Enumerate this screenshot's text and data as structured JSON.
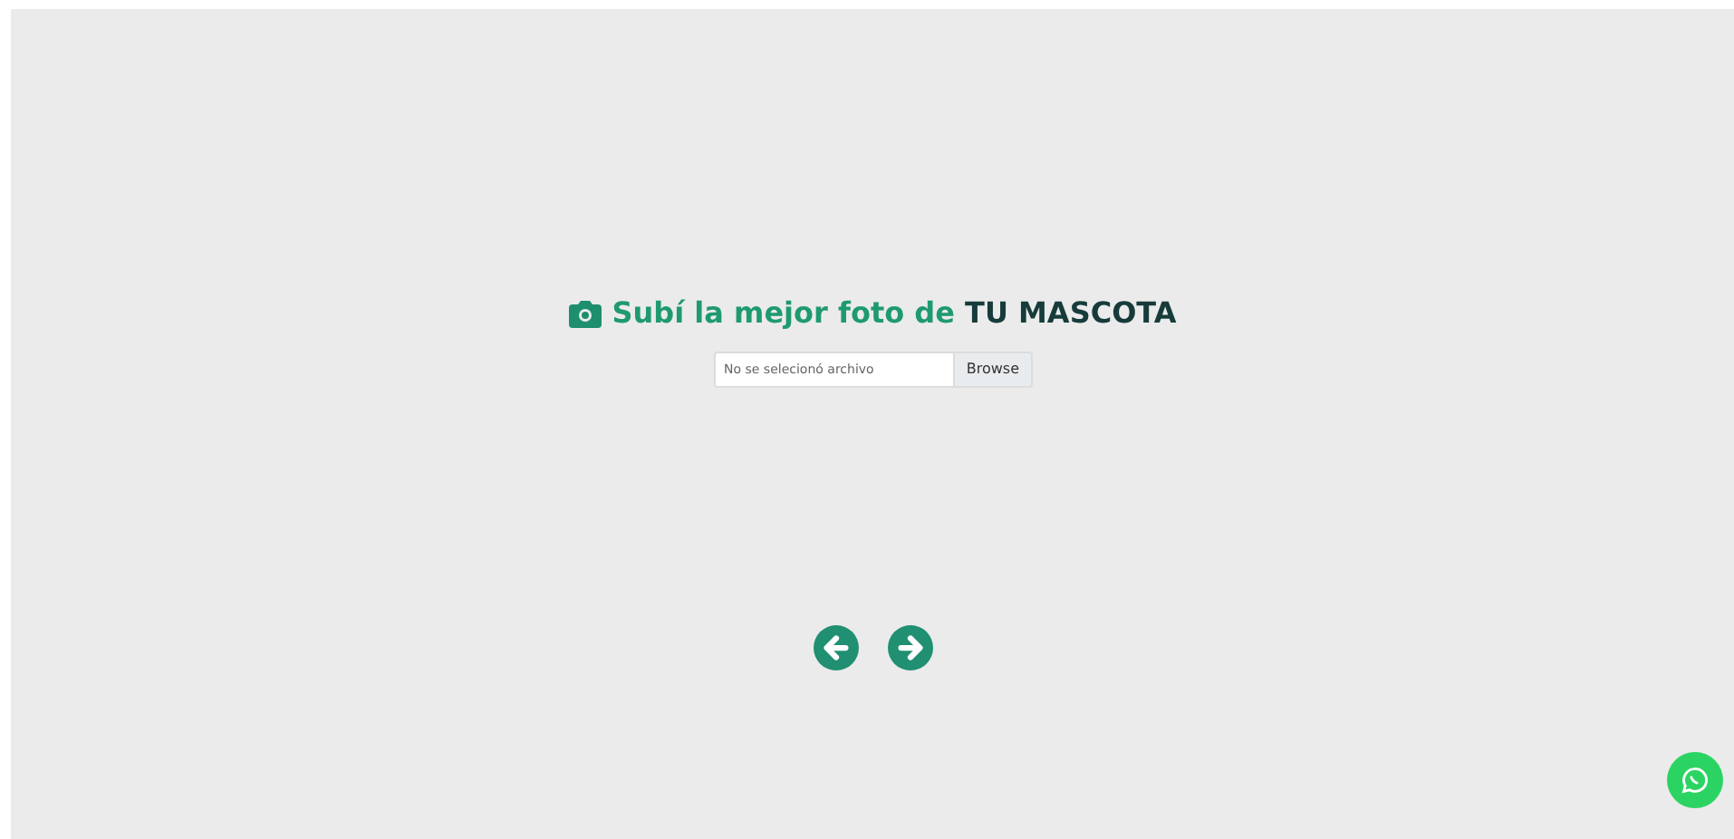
{
  "heading": {
    "lead": "Subí la mejor foto de",
    "emphasis": "TU MASCOTA"
  },
  "file_input": {
    "placeholder": "No se selecionó archivo",
    "button": "Browse"
  }
}
